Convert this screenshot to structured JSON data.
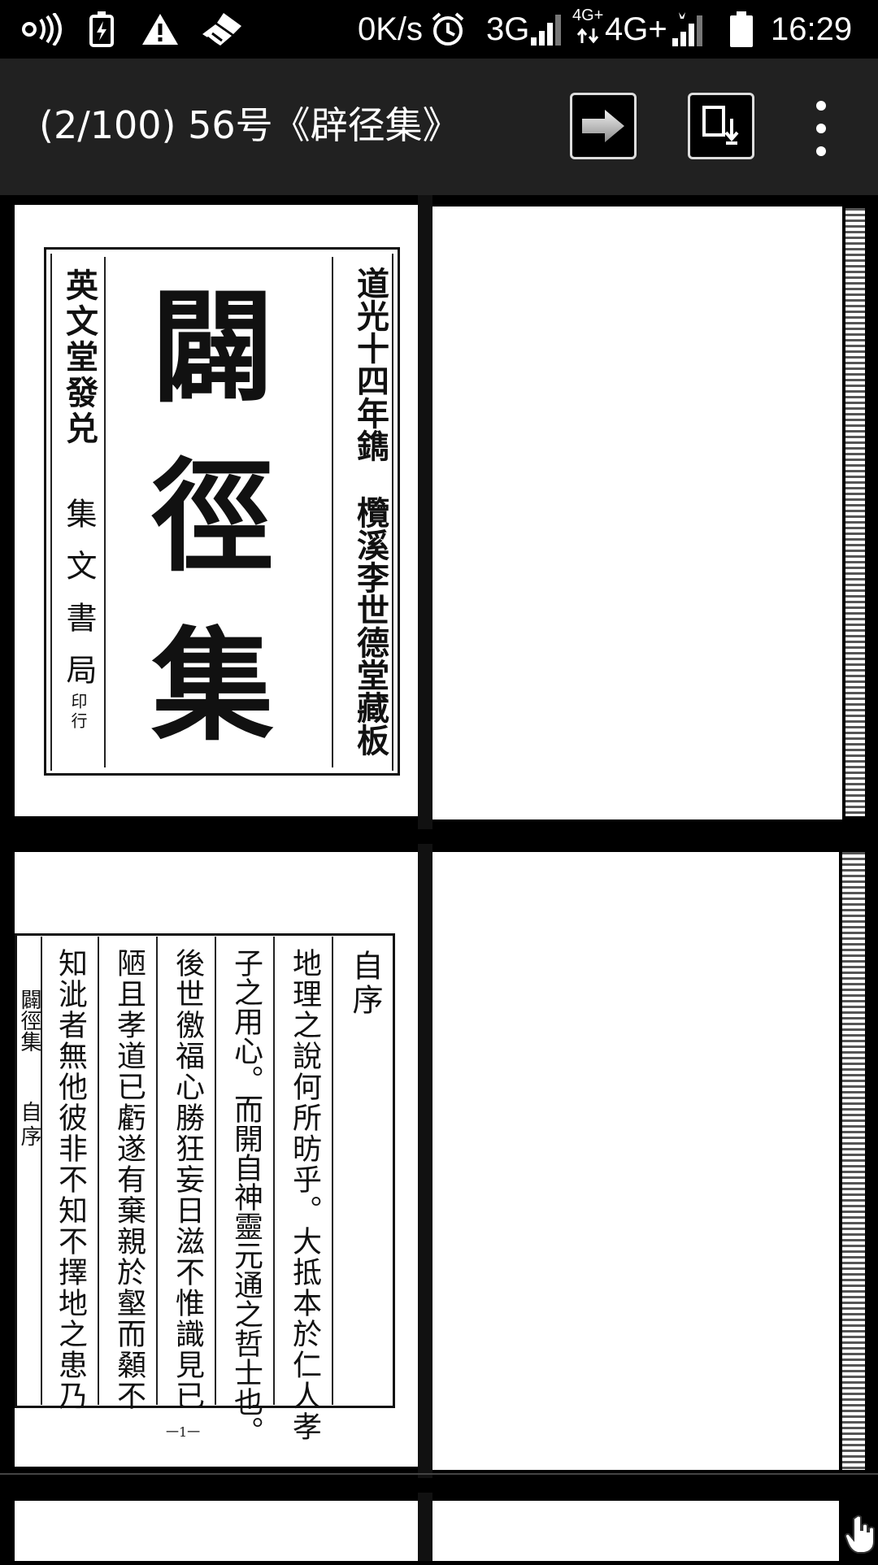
{
  "status_bar": {
    "speed": "0K/s",
    "network_3g": "3G",
    "network_4g_small": "4G+",
    "network_4g": "4G+",
    "time": "16:29"
  },
  "app_bar": {
    "title": "(2/100) 56号《辟径集》"
  },
  "page1": {
    "left_column": "英文堂發兑",
    "publisher": "集文書局",
    "printed": "印行",
    "main_title": "闢徑集",
    "right_top": "道光十四年鐫",
    "right_bottom": "欖溪李世德堂藏板"
  },
  "page2": {
    "heading": "自序",
    "columns": [
      "地理之說何所昉乎。大抵本於仁人孝",
      "子之用心。而開自神靈元通之哲士也。",
      "後世徼福心勝狂妄日滋不惟識見已",
      "陋且孝道已虧遂有棄親於壑而顙不",
      "知泚者無他彼非不知不擇地之患乃"
    ],
    "margin_text": "闢徑集",
    "margin_sub": "自序",
    "page_number": "一1一"
  }
}
